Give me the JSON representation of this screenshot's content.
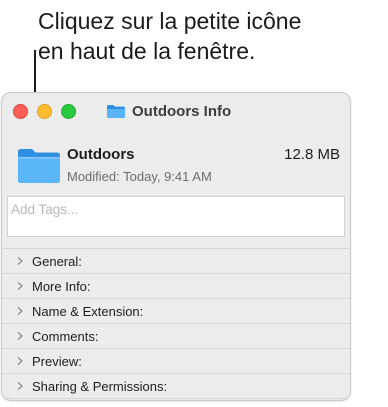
{
  "callout": {
    "line1": "Cliquez sur la petite icône",
    "line2": "en haut de la fenêtre."
  },
  "window": {
    "title": "Outdoors Info",
    "title_icon": "folder-icon"
  },
  "file": {
    "name": "Outdoors",
    "size": "12.8 MB",
    "modified": "Modified: Today, 9:41 AM",
    "icon": "folder-icon"
  },
  "tags": {
    "placeholder": "Add Tags..."
  },
  "sections": [
    {
      "label": "General:"
    },
    {
      "label": "More Info:"
    },
    {
      "label": "Name & Extension:"
    },
    {
      "label": "Comments:"
    },
    {
      "label": "Preview:"
    },
    {
      "label": "Sharing & Permissions:"
    }
  ],
  "colors": {
    "close": "#fe5f57",
    "minimize": "#febc2e",
    "zoom": "#28c840",
    "folder": "#4aaef0"
  }
}
